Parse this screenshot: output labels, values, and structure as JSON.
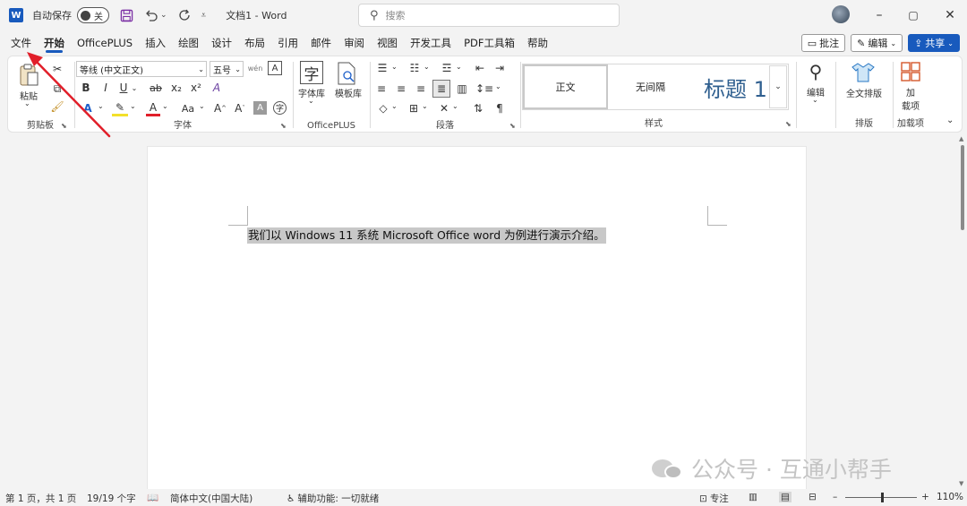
{
  "titlebar": {
    "logo": "W",
    "autosave_label": "自动保存",
    "autosave_state": "关",
    "doc_title": "文档1 - Word",
    "search_placeholder": "搜索",
    "save_icon": "save-icon",
    "undo_icon": "undo-icon",
    "redo_icon": "redo-icon"
  },
  "window": {
    "minimize": "–",
    "maximize": "▢",
    "close": "✕"
  },
  "tabs": [
    "文件",
    "开始",
    "OfficePLUS",
    "插入",
    "绘图",
    "设计",
    "布局",
    "引用",
    "邮件",
    "审阅",
    "视图",
    "开发工具",
    "PDF工具箱",
    "帮助"
  ],
  "active_tab": "开始",
  "tab_actions": {
    "comment": "批注",
    "edit": "编辑",
    "share": "共享"
  },
  "ribbon": {
    "clipboard": {
      "paste": "粘贴",
      "label": "剪贴板"
    },
    "font": {
      "font_name": "等线 (中文正文)",
      "font_size": "五号",
      "label": "字体",
      "bold": "B",
      "italic": "I",
      "underline": "U",
      "strike": "ab",
      "sub": "x₂",
      "sup": "x²"
    },
    "officeplus": {
      "font_lib": "字体库",
      "template_lib": "模板库",
      "label": "OfficePLUS"
    },
    "paragraph": {
      "label": "段落"
    },
    "styles": {
      "normal": "正文",
      "no_spacing": "无间隔",
      "heading1": "标题 1",
      "label": "样式"
    },
    "editing": {
      "edit": "编辑"
    },
    "layout": {
      "full_layout": "全文排版",
      "label": "排版"
    },
    "addins": {
      "addin": "加\n载项",
      "label": "加载项"
    }
  },
  "document": {
    "text": "我们以 Windows 11 系统 Microsoft Office word 为例进行演示介绍。"
  },
  "statusbar": {
    "page": "第 1 页，共 1 页",
    "words": "19/19 个字",
    "language": "简体中文(中国大陆)",
    "accessibility": "辅助功能: 一切就绪",
    "focus": "专注",
    "zoom": "110%"
  },
  "watermark": {
    "text": "公众号 · 互通小帮手"
  },
  "colors": {
    "accent": "#185abd",
    "annotation": "#e11f2a"
  }
}
